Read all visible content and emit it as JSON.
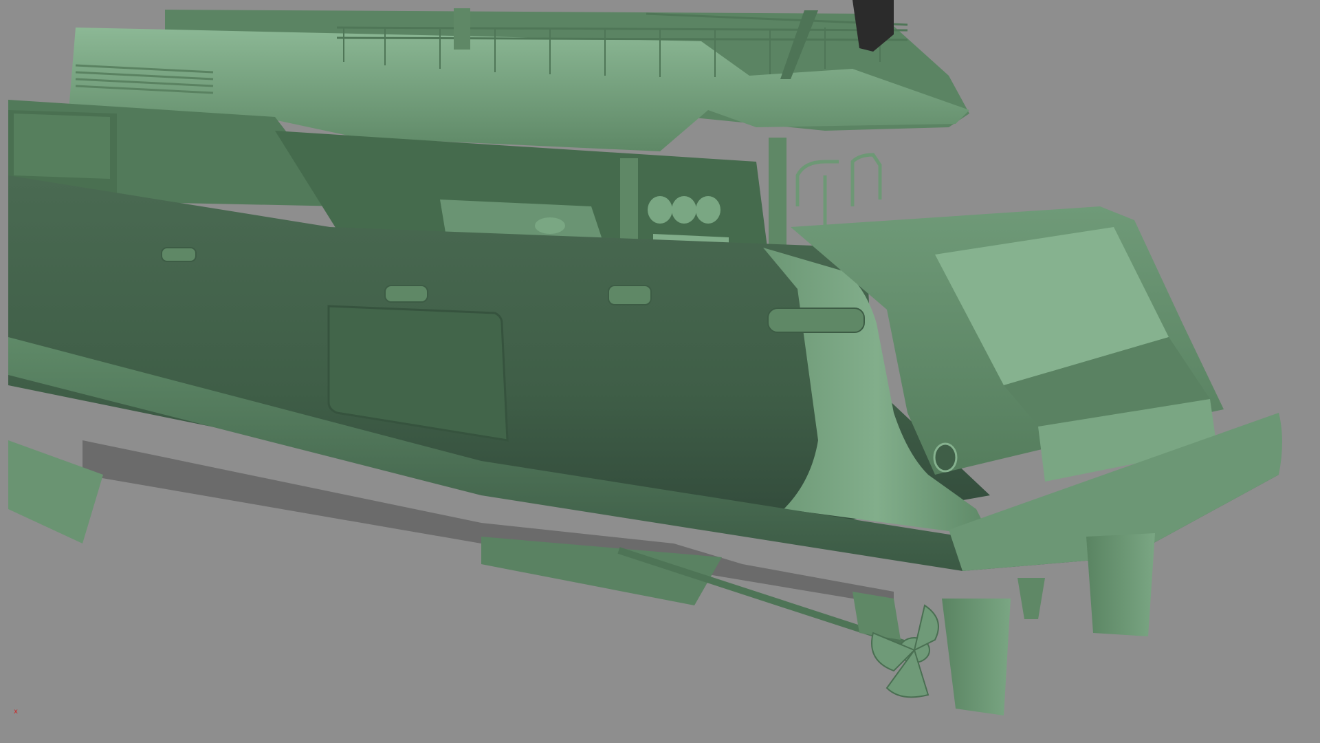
{
  "viewport": {
    "background_color": "#8e8e8e",
    "model_color": "#6f9a78",
    "model_shadow_color": "#3f5c46",
    "model_highlight_color": "#9cc6a3",
    "axis_label": "x",
    "axis_color": "#d21c1c"
  },
  "scene": {
    "subject": "yacht-stern-3d-model",
    "render_mode": "solid-shaded"
  }
}
